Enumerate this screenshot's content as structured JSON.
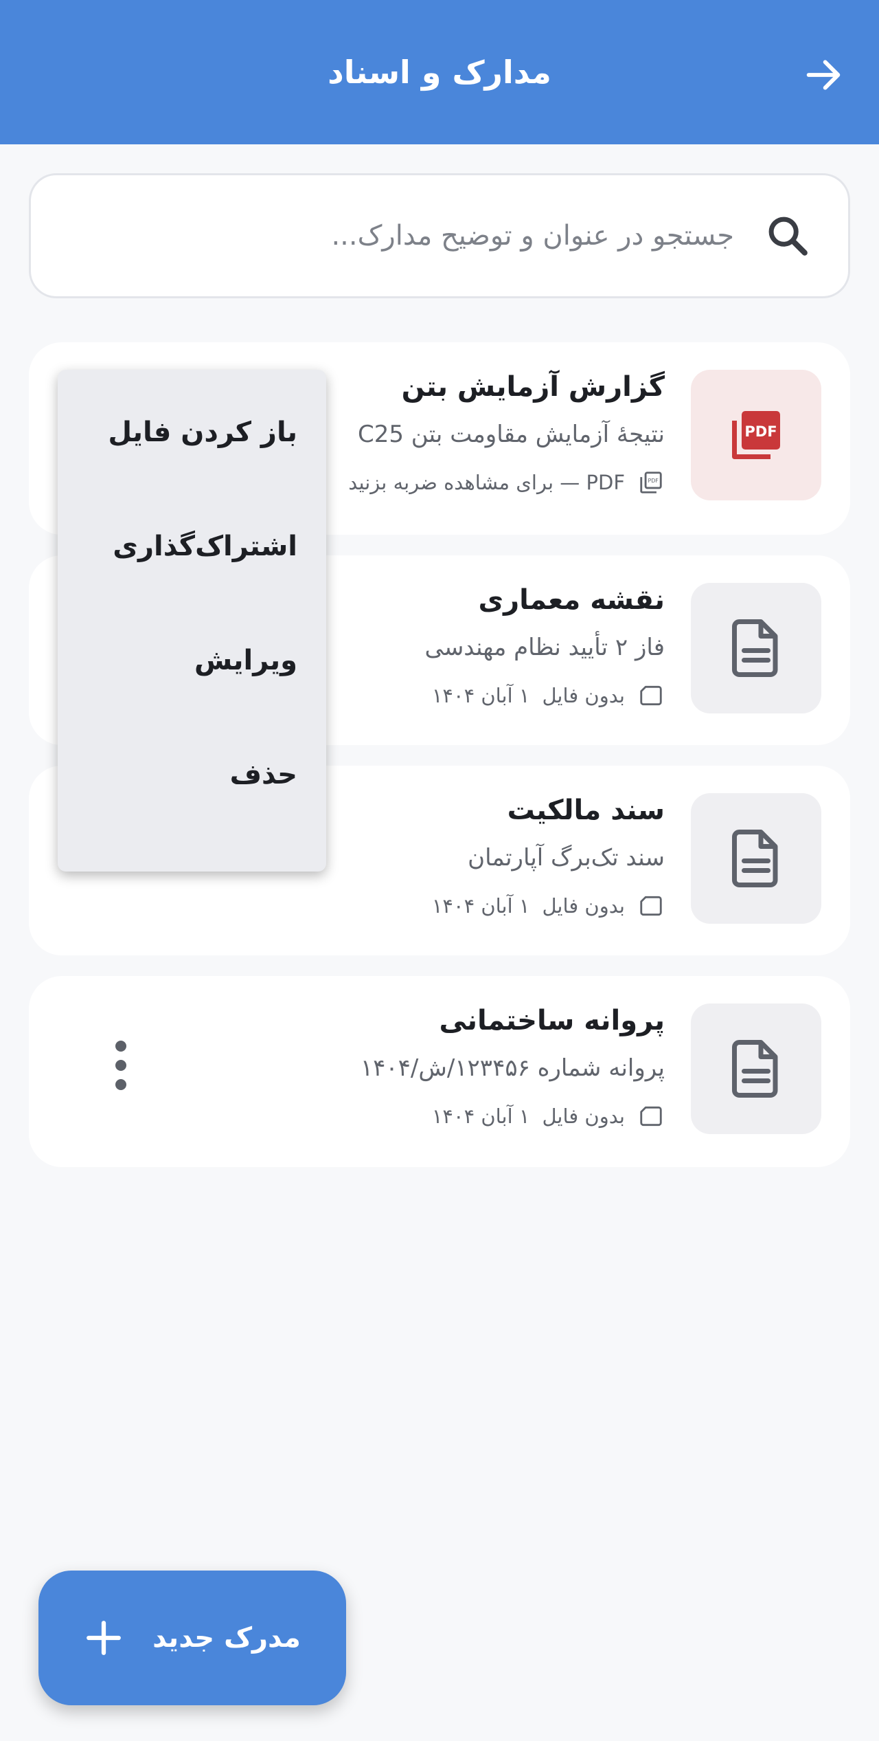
{
  "header": {
    "title": "مدارک و اسناد"
  },
  "search": {
    "placeholder": "جستجو در عنوان و توضیح مدارک..."
  },
  "documents": [
    {
      "title": "گزارش آزمایش بتن",
      "description": "نتیجهٔ آزمایش مقاومت بتن C25",
      "meta": "PDF — برای مشاهده ضربه بزنید",
      "icon": "pdf-icon"
    },
    {
      "title": "نقشه معماری",
      "description": "فاز ۲ تأیید نظام مهندسی",
      "file_status": "بدون فایل",
      "date": "۱ آبان ۱۴۰۴",
      "icon": "document-icon"
    },
    {
      "title": "سند مالکیت",
      "description": "سند تک‌برگ آپارتمان",
      "file_status": "بدون فایل",
      "date": "۱ آبان ۱۴۰۴",
      "icon": "document-icon"
    },
    {
      "title": "پروانه ساختمانی",
      "description": "پروانه شماره ۱۲۳۴۵۶/ش/۱۴۰۴",
      "file_status": "بدون فایل",
      "date": "۱ آبان ۱۴۰۴",
      "icon": "document-icon"
    }
  ],
  "context_menu": {
    "items": [
      "باز کردن فایل",
      "اشتراک‌گذاری",
      "ویرایش",
      "حذف"
    ]
  },
  "fab": {
    "label": "مدرک جدید"
  },
  "colors": {
    "primary": "#4a86da",
    "pdf_red": "#c9383a",
    "background": "#f7f8fa"
  }
}
